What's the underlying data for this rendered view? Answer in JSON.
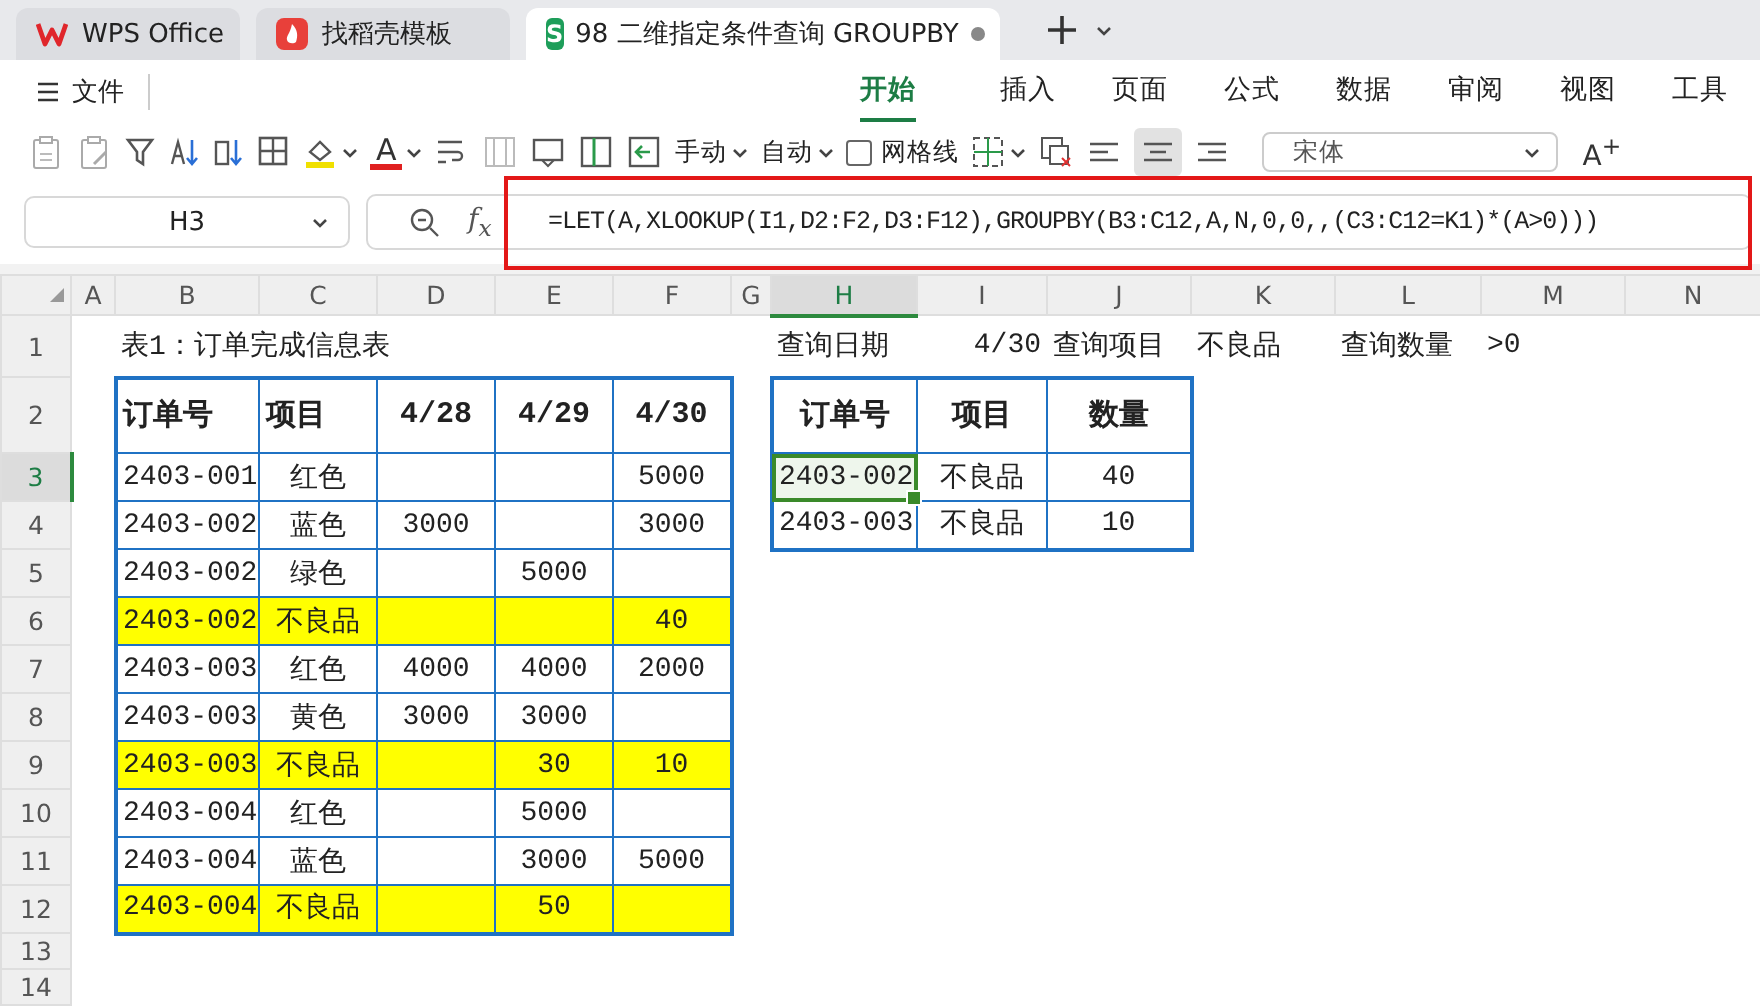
{
  "tabs": [
    {
      "label": "WPS Office",
      "kind": "wps",
      "selected": false
    },
    {
      "label": "找稻壳模板",
      "kind": "docer",
      "selected": false
    },
    {
      "label": "98 二维指定条件查询 GROUPBY",
      "kind": "sheet",
      "badge": "S",
      "selected": true,
      "unsaved": true
    }
  ],
  "menu": {
    "file": "文件",
    "items": [
      {
        "label": "开始",
        "selected": true
      },
      {
        "label": "插入",
        "selected": false
      },
      {
        "label": "页面",
        "selected": false
      },
      {
        "label": "公式",
        "selected": false
      },
      {
        "label": "数据",
        "selected": false
      },
      {
        "label": "审阅",
        "selected": false
      },
      {
        "label": "视图",
        "selected": false
      },
      {
        "label": "工具",
        "selected": false
      }
    ]
  },
  "toolbar": {
    "font_color_glyph": "A",
    "row_height": "手动",
    "col_width": "自动",
    "gridlines": {
      "label": "网格线",
      "checked": false
    },
    "font": "宋体",
    "grow_font": "A$^{+}$"
  },
  "formula_bar": {
    "name_box": "H3",
    "function_glyph": "f$_{x}$",
    "formula": "=LET(A,XLOOKUP(I1,D2:F2,D3:F12),GROUPBY(B3:C12,A,N,0,0,,(C3:C12=K1)*(A>0)))",
    "highlighted": true
  },
  "sheet": {
    "columns": [
      "A",
      "B",
      "C",
      "D",
      "E",
      "F",
      "G",
      "H",
      "I",
      "J",
      "K",
      "L",
      "M",
      "N"
    ],
    "rows": [
      "1",
      "2",
      "3",
      "4",
      "5",
      "6",
      "7",
      "8",
      "9",
      "10",
      "11",
      "12",
      "13",
      "14"
    ],
    "title": "表1：订单完成信息表",
    "query": [
      {
        "text": "查询日期",
        "kind": "label"
      },
      {
        "text": "4/30",
        "kind": "date"
      },
      {
        "text": "查询项目",
        "kind": "label"
      },
      {
        "text": "不良品",
        "kind": "value"
      },
      {
        "text": "查询数量",
        "kind": "label"
      },
      {
        "text": ">0",
        "kind": "value"
      }
    ],
    "orders": {
      "columns": [
        "订单号",
        "项目",
        "4/28",
        "4/29",
        "4/30"
      ],
      "rows": [
        {
          "cells": [
            "2403-001",
            "红色",
            null,
            null,
            "5000"
          ],
          "highlighted": false
        },
        {
          "cells": [
            "2403-002",
            "蓝色",
            "3000",
            null,
            "3000"
          ],
          "highlighted": false
        },
        {
          "cells": [
            "2403-002",
            "绿色",
            null,
            "5000",
            null
          ],
          "highlighted": false
        },
        {
          "cells": [
            "2403-002",
            "不良品",
            null,
            null,
            "40"
          ],
          "highlighted": true
        },
        {
          "cells": [
            "2403-003",
            "红色",
            "4000",
            "4000",
            "2000"
          ],
          "highlighted": false
        },
        {
          "cells": [
            "2403-003",
            "黄色",
            "3000",
            "3000",
            null
          ],
          "highlighted": false
        },
        {
          "cells": [
            "2403-003",
            "不良品",
            null,
            "30",
            "10"
          ],
          "highlighted": true
        },
        {
          "cells": [
            "2403-004",
            "红色",
            null,
            "5000",
            null
          ],
          "highlighted": false
        },
        {
          "cells": [
            "2403-004",
            "蓝色",
            null,
            "3000",
            "5000"
          ],
          "highlighted": false
        },
        {
          "cells": [
            "2403-004",
            "不良品",
            null,
            "50",
            null
          ],
          "highlighted": true
        }
      ]
    },
    "result": {
      "columns": [
        "订单号",
        "项目",
        "数量"
      ],
      "rows": [
        {
          "cells": [
            {
              "text": "2403-002",
              "selected": true
            },
            {
              "text": "不良品",
              "selected": false
            },
            {
              "text": "40",
              "selected": false
            }
          ]
        },
        {
          "cells": [
            {
              "text": "2403-003",
              "selected": false
            },
            {
              "text": "不良品",
              "selected": false
            },
            {
              "text": "10",
              "selected": false
            }
          ]
        }
      ]
    }
  }
}
